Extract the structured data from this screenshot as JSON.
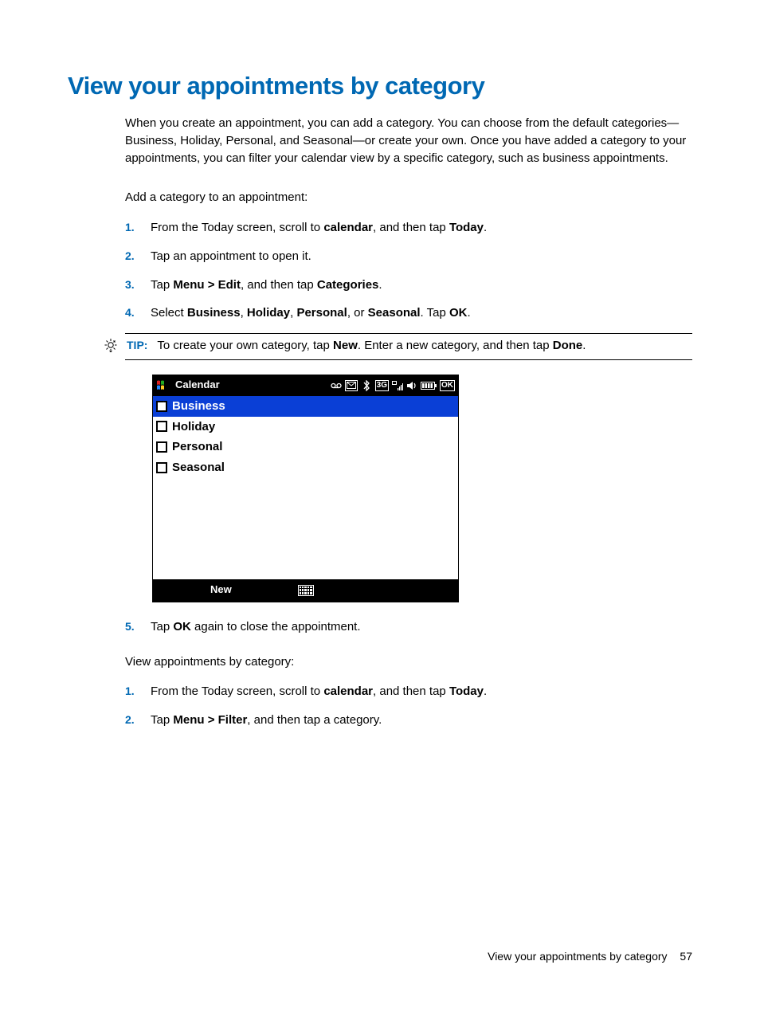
{
  "heading": "View your appointments by category",
  "intro": "When you create an appointment, you can add a category. You can choose from the default categories—Business, Holiday, Personal, and Seasonal—or create your own. Once you have added a category to your appointments, you can filter your calendar view by a specific category, such as business appointments.",
  "section1_lead": "Add a category to an appointment:",
  "steps1": [
    {
      "marker": "1.",
      "pre": "From the Today screen, scroll to ",
      "b1": "calendar",
      "mid": ", and then tap ",
      "b2": "Today",
      "post": "."
    },
    {
      "marker": "2.",
      "pre": "Tap an appointment to open it."
    },
    {
      "marker": "3.",
      "pre": "Tap ",
      "b1": "Menu > Edit",
      "mid": ", and then tap ",
      "b2": "Categories",
      "post": "."
    },
    {
      "marker": "4.",
      "pre": "Select ",
      "b1": "Business",
      "mid": ", ",
      "b2": "Holiday",
      "mid2": ", ",
      "b3": "Personal",
      "mid3": ", or ",
      "b4": "Seasonal",
      "post": ". Tap ",
      "b5": "OK",
      "post2": "."
    }
  ],
  "tip": {
    "label": "TIP:",
    "pre": "To create your own category, tap ",
    "b1": "New",
    "mid": ". Enter a new category, and then tap ",
    "b2": "Done",
    "post": "."
  },
  "device": {
    "title": "Calendar",
    "status": {
      "voicemail": "⚆",
      "mail": "✉",
      "bluetooth": "✱",
      "network": "3G",
      "signal": "▮",
      "speaker": "◀",
      "battery": "▥",
      "ok": "OK"
    },
    "categories": [
      {
        "label": "Business",
        "checked": true,
        "selected": true
      },
      {
        "label": "Holiday",
        "checked": false,
        "selected": false
      },
      {
        "label": "Personal",
        "checked": false,
        "selected": false
      },
      {
        "label": "Seasonal",
        "checked": false,
        "selected": false
      }
    ],
    "softkey_new": "New"
  },
  "step5": {
    "marker": "5.",
    "pre": "Tap ",
    "b1": "OK",
    "post": " again to close the appointment."
  },
  "section2_lead": "View appointments by category:",
  "steps2": [
    {
      "marker": "1.",
      "pre": "From the Today screen, scroll to ",
      "b1": "calendar",
      "mid": ", and then tap ",
      "b2": "Today",
      "post": "."
    },
    {
      "marker": "2.",
      "pre": "Tap ",
      "b1": "Menu > Filter",
      "post": ", and then tap a category."
    }
  ],
  "footer": {
    "text": "View your appointments by category",
    "page": "57"
  }
}
